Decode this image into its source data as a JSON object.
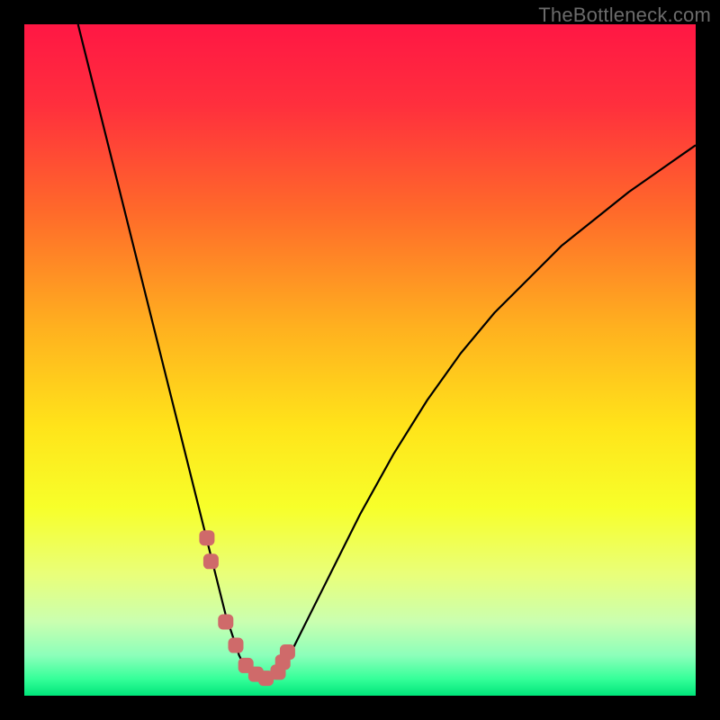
{
  "watermark": "TheBottleneck.com",
  "colors": {
    "frame": "#000000",
    "watermark": "#6b6b6b",
    "curve": "#000000",
    "marker_fill": "#cf6a6a",
    "marker_stroke": "#cf6a6a",
    "gradient_stops": [
      {
        "offset": 0.0,
        "color": "#ff1744"
      },
      {
        "offset": 0.12,
        "color": "#ff2f3d"
      },
      {
        "offset": 0.28,
        "color": "#ff6a2a"
      },
      {
        "offset": 0.45,
        "color": "#ffb01f"
      },
      {
        "offset": 0.6,
        "color": "#ffe41a"
      },
      {
        "offset": 0.72,
        "color": "#f7ff2a"
      },
      {
        "offset": 0.82,
        "color": "#e9ff7a"
      },
      {
        "offset": 0.89,
        "color": "#caffb0"
      },
      {
        "offset": 0.94,
        "color": "#8cffba"
      },
      {
        "offset": 0.975,
        "color": "#35ff99"
      },
      {
        "offset": 1.0,
        "color": "#00e57a"
      }
    ]
  },
  "chart_data": {
    "type": "line",
    "title": "",
    "xlabel": "",
    "ylabel": "",
    "xlim": [
      0,
      100
    ],
    "ylim": [
      0,
      100
    ],
    "grid": false,
    "legend": false,
    "series": [
      {
        "name": "bottleneck-curve",
        "x": [
          8,
          10,
          12,
          14,
          16,
          18,
          20,
          22,
          24,
          26,
          27,
          28,
          29,
          30,
          31,
          32,
          33,
          34,
          35,
          36,
          37,
          38,
          40,
          42,
          45,
          50,
          55,
          60,
          65,
          70,
          75,
          80,
          85,
          90,
          95,
          100
        ],
        "y": [
          100,
          92,
          84,
          76,
          68,
          60,
          52,
          44,
          36,
          28,
          24,
          20,
          16,
          12,
          9,
          6,
          4,
          3,
          2.7,
          2.5,
          3,
          4,
          7,
          11,
          17,
          27,
          36,
          44,
          51,
          57,
          62,
          67,
          71,
          75,
          78.5,
          82
        ]
      }
    ],
    "markers": {
      "name": "highlight-points",
      "x": [
        27.2,
        27.8,
        30.0,
        31.5,
        33.0,
        34.5,
        36.0,
        37.8,
        38.5,
        39.2
      ],
      "y": [
        23.5,
        20.0,
        11.0,
        7.5,
        4.5,
        3.2,
        2.6,
        3.5,
        5.0,
        6.5
      ]
    }
  }
}
